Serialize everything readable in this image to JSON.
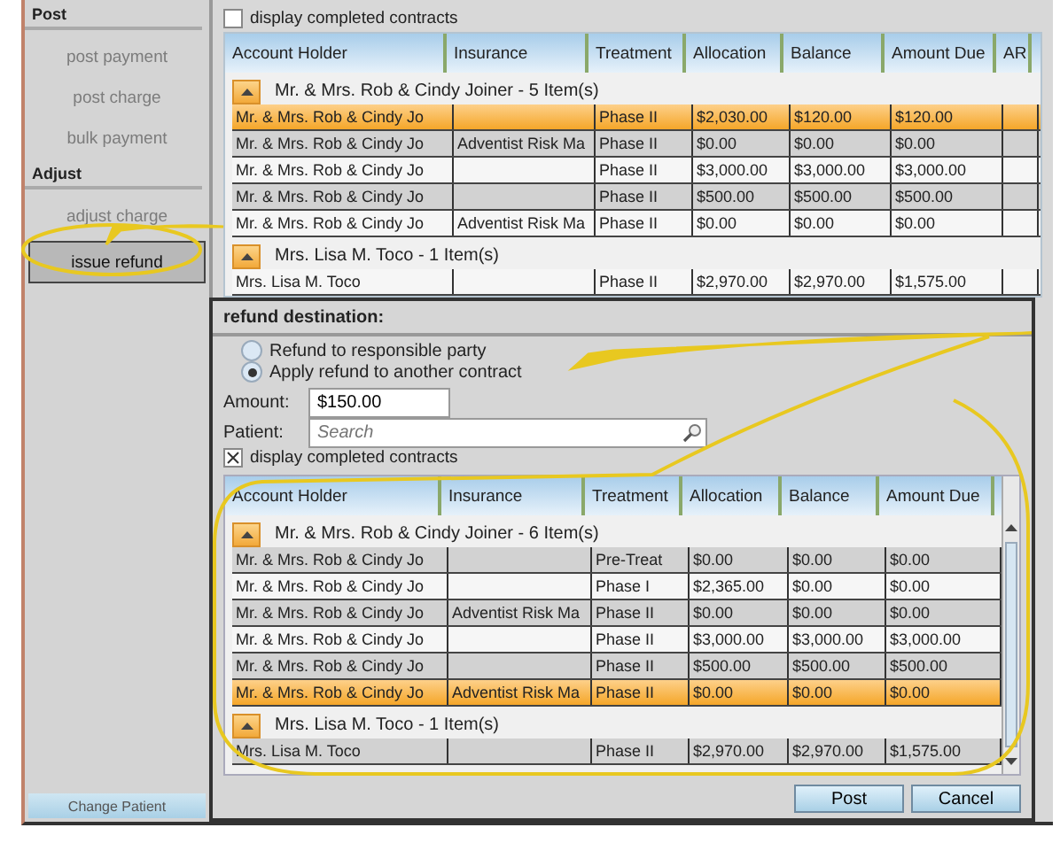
{
  "sidebar": {
    "sections": [
      {
        "title": "Post",
        "items": [
          {
            "label": "post payment",
            "disabled": true,
            "selected": false
          },
          {
            "label": "post charge",
            "disabled": true,
            "selected": false
          },
          {
            "label": "bulk payment",
            "disabled": true,
            "selected": false
          }
        ]
      },
      {
        "title": "Adjust",
        "items": [
          {
            "label": "adjust charge",
            "disabled": true,
            "selected": false
          },
          {
            "label": "issue refund",
            "disabled": false,
            "selected": true
          }
        ]
      }
    ],
    "change_patient_button": "Change Patient"
  },
  "contracts": {
    "display_completed": {
      "label": "display completed contracts",
      "checked": false
    },
    "columns": [
      "Account Holder",
      "Insurance",
      "Treatment",
      "Allocation",
      "Balance",
      "Amount Due",
      "AR"
    ],
    "groups": [
      {
        "title": "Mr. & Mrs. Rob & Cindy Joiner - 5 Item(s)",
        "expanded": true,
        "rows": [
          {
            "selected": true,
            "cells": [
              "Mr. & Mrs. Rob & Cindy Jo",
              "",
              "Phase II",
              "$2,030.00",
              "$120.00",
              "$120.00",
              ""
            ]
          },
          {
            "selected": false,
            "cells": [
              "Mr. & Mrs. Rob & Cindy Jo",
              "Adventist Risk Ma",
              "Phase II",
              "$0.00",
              "$0.00",
              "$0.00",
              ""
            ]
          },
          {
            "selected": false,
            "cells": [
              "Mr. & Mrs. Rob & Cindy Jo",
              "",
              "Phase II",
              "$3,000.00",
              "$3,000.00",
              "$3,000.00",
              ""
            ]
          },
          {
            "selected": false,
            "cells": [
              "Mr. & Mrs. Rob & Cindy Jo",
              "",
              "Phase II",
              "$500.00",
              "$500.00",
              "$500.00",
              ""
            ]
          },
          {
            "selected": false,
            "cells": [
              "Mr. & Mrs. Rob & Cindy Jo",
              "Adventist Risk Ma",
              "Phase II",
              "$0.00",
              "$0.00",
              "$0.00",
              ""
            ]
          }
        ]
      },
      {
        "title": "Mrs. Lisa M. Toco - 1 Item(s)",
        "expanded": true,
        "rows": [
          {
            "selected": false,
            "cells": [
              "Mrs. Lisa M. Toco",
              "",
              "Phase II",
              "$2,970.00",
              "$2,970.00",
              "$1,575.00",
              ""
            ]
          }
        ]
      }
    ]
  },
  "refund_dialog": {
    "title": "refund destination:",
    "options": [
      {
        "label": "Refund to responsible party",
        "selected": false
      },
      {
        "label": "Apply refund to another contract",
        "selected": true
      }
    ],
    "amount": {
      "label": "Amount:",
      "value": "$150.00"
    },
    "patient": {
      "label": "Patient:",
      "placeholder": "Search"
    },
    "display_completed": {
      "label": "display completed contracts",
      "checked": true
    },
    "columns": [
      "Account Holder",
      "Insurance",
      "Treatment",
      "Allocation",
      "Balance",
      "Amount Due"
    ],
    "groups": [
      {
        "title": "Mr. & Mrs. Rob & Cindy Joiner - 6 Item(s)",
        "expanded": true,
        "rows": [
          {
            "selected": false,
            "cells": [
              "Mr. & Mrs. Rob & Cindy Jo",
              "",
              "Pre-Treat",
              "$0.00",
              "$0.00",
              "$0.00"
            ]
          },
          {
            "selected": false,
            "cells": [
              "Mr. & Mrs. Rob & Cindy Jo",
              "",
              "Phase I",
              "$2,365.00",
              "$0.00",
              "$0.00"
            ]
          },
          {
            "selected": false,
            "cells": [
              "Mr. & Mrs. Rob & Cindy Jo",
              "Adventist Risk Ma",
              "Phase II",
              "$0.00",
              "$0.00",
              "$0.00"
            ]
          },
          {
            "selected": false,
            "cells": [
              "Mr. & Mrs. Rob & Cindy Jo",
              "",
              "Phase II",
              "$3,000.00",
              "$3,000.00",
              "$3,000.00"
            ]
          },
          {
            "selected": false,
            "cells": [
              "Mr. & Mrs. Rob & Cindy Jo",
              "",
              "Phase II",
              "$500.00",
              "$500.00",
              "$500.00"
            ]
          },
          {
            "selected": true,
            "cells": [
              "Mr. & Mrs. Rob & Cindy Jo",
              "Adventist Risk Ma",
              "Phase II",
              "$0.00",
              "$0.00",
              "$0.00"
            ]
          }
        ]
      },
      {
        "title": "Mrs. Lisa M. Toco - 1 Item(s)",
        "expanded": true,
        "rows": [
          {
            "selected": false,
            "cells": [
              "Mrs. Lisa M. Toco",
              "",
              "Phase II",
              "$2,970.00",
              "$2,970.00",
              "$1,575.00"
            ]
          }
        ]
      }
    ],
    "buttons": [
      "Post",
      "Cancel"
    ]
  }
}
